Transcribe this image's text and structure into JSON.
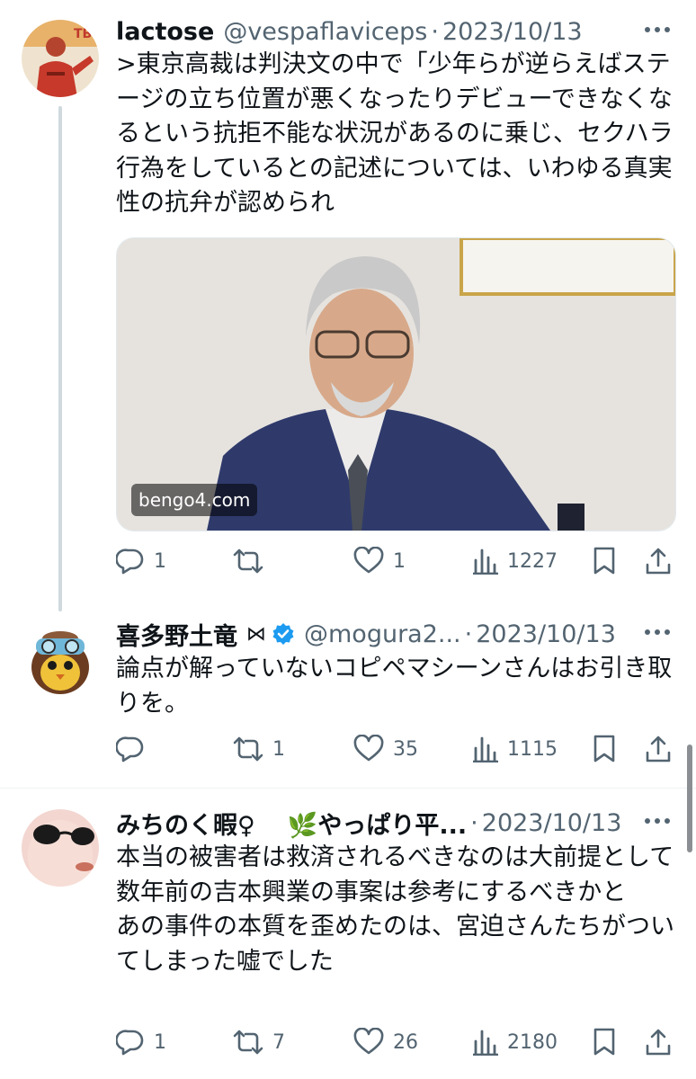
{
  "tweets": [
    {
      "name": "lactose",
      "handle": "@vespaflaviceps",
      "date": "2023/10/13",
      "text": ">東京高裁は判決文の中で「少年らが逆らえばステージの立ち位置が悪くなったりデビューできなくなるという抗拒不能な状況があるのに乗じ、セクハラ行為をしているとの記述については、いわゆる真実性の抗弁が認められ",
      "media_source": "bengo4.com",
      "replies": "1",
      "retweets": "",
      "likes": "1",
      "views": "1227"
    },
    {
      "name": "喜多野土竜",
      "name_suffix": "⋈",
      "handle": "@mogura2...",
      "date": "2023/10/13",
      "text": "論点が解っていないコピペマシーンさんはお引き取りを。",
      "replies": "",
      "retweets": "1",
      "likes": "35",
      "views": "1115"
    },
    {
      "name": "みちのく暇♀",
      "name_extra": "🌿やっぱり平...",
      "date": "2023/10/13",
      "text": "本当の被害者は救済されるべきなのは大前提として\n数年前の吉本興業の事案は参考にするべきかと\nあの事件の本質を歪めたのは、宮迫さんたちがついてしまった嘘でした",
      "replies": "1",
      "retweets": "7",
      "likes": "26",
      "views": "2180"
    }
  ],
  "dot": "·",
  "colors": {
    "text": "#0f1419",
    "secondary": "#536471",
    "verified": "#1d9bf0",
    "thread_line": "#cfd9de"
  },
  "icons": [
    "reply-icon",
    "retweet-icon",
    "like-icon",
    "views-icon",
    "bookmark-icon",
    "share-icon",
    "more-icon",
    "verified-badge-icon"
  ]
}
